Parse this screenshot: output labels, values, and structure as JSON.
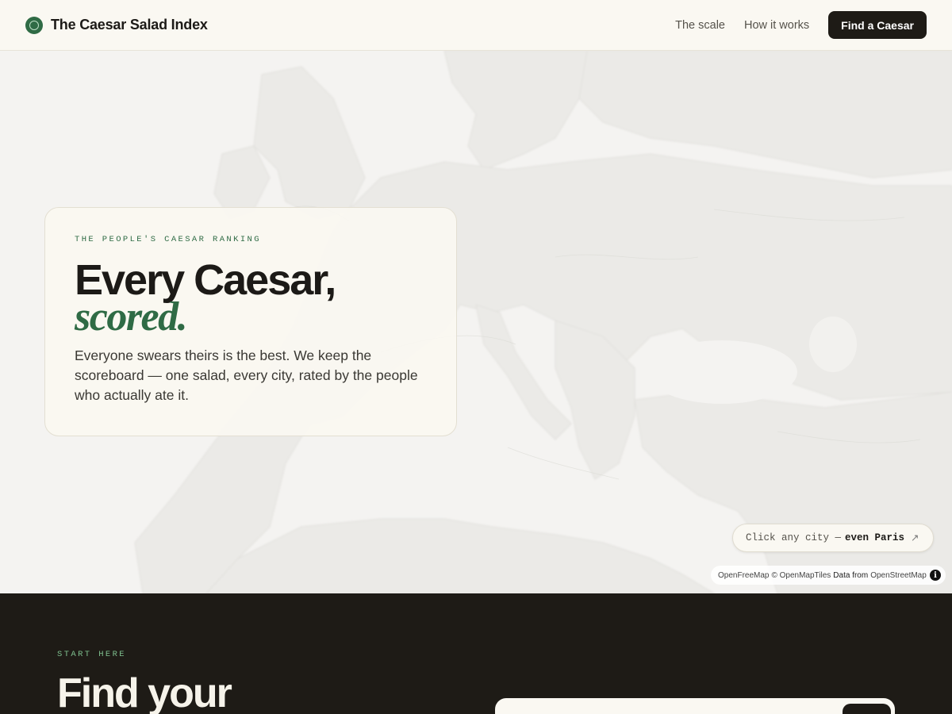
{
  "header": {
    "brand": "The Caesar Salad Index",
    "nav": [
      {
        "label": "The scale"
      },
      {
        "label": "How it works"
      }
    ],
    "cta_label": "Find a Caesar"
  },
  "hero": {
    "eyebrow": "THE PEOPLE'S CAESAR RANKING",
    "title_line1": "Every Caesar,",
    "title_line2": "scored.",
    "description": "Everyone swears theirs is the best. We keep the scoreboard — one salad, every city, rated by the people who actually ate it."
  },
  "map": {
    "hint_prefix": "Click any city —",
    "hint_emphasis": "even Paris",
    "hint_arrow": "↗",
    "attribution": {
      "openfreemap": "OpenFreeMap",
      "openmaptiles": "© OpenMapTiles",
      "data_from": "Data from",
      "osm": "OpenStreetMap",
      "info_symbol": "i"
    }
  },
  "start": {
    "eyebrow": "START HERE",
    "title": "Find your"
  }
}
